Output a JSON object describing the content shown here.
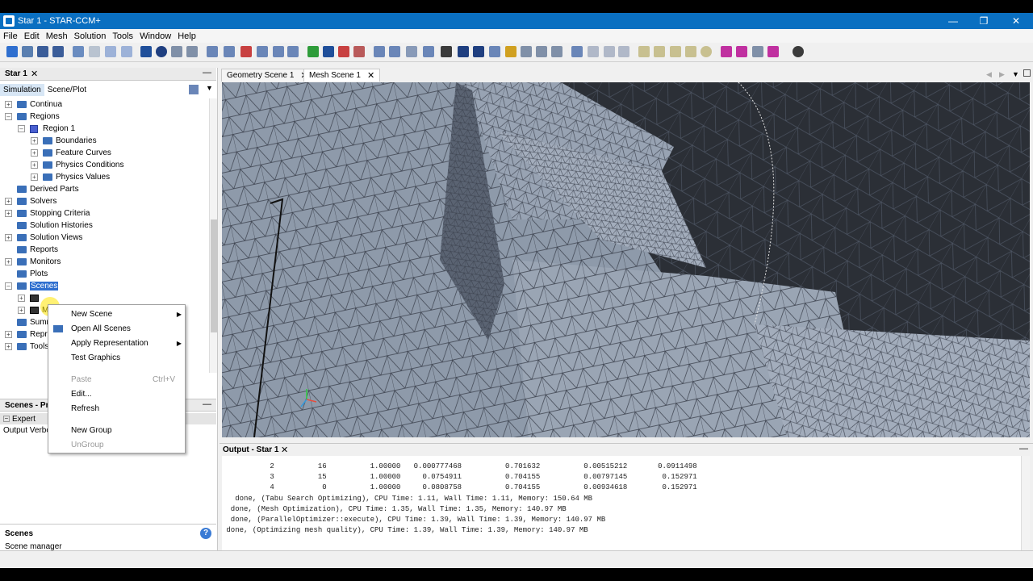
{
  "window": {
    "title": "Star 1 - STAR-CCM+"
  },
  "menu": [
    "File",
    "Edit",
    "Mesh",
    "Solution",
    "Tools",
    "Window",
    "Help"
  ],
  "left_panel": {
    "tab": "Star 1",
    "subtabs": [
      "Simulation",
      "Scene/Plot"
    ],
    "tree": [
      {
        "label": "Continua",
        "level": 0,
        "icon": "folder-icon"
      },
      {
        "label": "Regions",
        "level": 0,
        "icon": "folder-icon"
      },
      {
        "label": "Region 1",
        "level": 1,
        "icon": "region-icon"
      },
      {
        "label": "Boundaries",
        "level": 2,
        "icon": "folder-icon"
      },
      {
        "label": "Feature Curves",
        "level": 2,
        "icon": "folder-icon"
      },
      {
        "label": "Physics Conditions",
        "level": 2,
        "icon": "folder-icon"
      },
      {
        "label": "Physics Values",
        "level": 2,
        "icon": "folder-icon"
      },
      {
        "label": "Derived Parts",
        "level": 0,
        "icon": "folder-icon"
      },
      {
        "label": "Solvers",
        "level": 0,
        "icon": "folder-icon"
      },
      {
        "label": "Stopping Criteria",
        "level": 0,
        "icon": "folder-icon"
      },
      {
        "label": "Solution Histories",
        "level": 0,
        "icon": "folder-icon"
      },
      {
        "label": "Solution Views",
        "level": 0,
        "icon": "folder-icon"
      },
      {
        "label": "Reports",
        "level": 0,
        "icon": "folder-icon"
      },
      {
        "label": "Monitors",
        "level": 0,
        "icon": "folder-icon"
      },
      {
        "label": "Plots",
        "level": 0,
        "icon": "folder-icon"
      },
      {
        "label": "Scenes",
        "level": 0,
        "icon": "folder-icon",
        "selected": true
      },
      {
        "label": "",
        "level": 1,
        "icon": "scene-icon"
      },
      {
        "label": "M",
        "level": 1,
        "icon": "scene-icon"
      },
      {
        "label": "Summ",
        "level": 0,
        "icon": "folder-icon"
      },
      {
        "label": "Repr",
        "level": 0,
        "icon": "folder-icon"
      },
      {
        "label": "Tools",
        "level": 0,
        "icon": "folder-icon"
      }
    ],
    "properties_title": "Scenes - Pr",
    "properties_rows": [
      "Expert",
      "Output Verbo"
    ],
    "help_title": "Scenes",
    "help_desc": "Scene manager"
  },
  "context_menu": [
    {
      "label": "New Scene",
      "submenu": true
    },
    {
      "label": "Open All Scenes",
      "icon": true
    },
    {
      "label": "Apply Representation",
      "submenu": true
    },
    {
      "label": "Test Graphics"
    },
    {
      "label": "Paste",
      "shortcut": "Ctrl+V",
      "disabled": true
    },
    {
      "label": "Edit..."
    },
    {
      "label": "Refresh"
    },
    {
      "label": "New Group"
    },
    {
      "label": "UnGroup",
      "disabled": true
    }
  ],
  "scene_tabs": [
    "Geometry Scene 1",
    "Mesh Scene 1"
  ],
  "active_scene_tab": 1,
  "output": {
    "tab": "Output - Star 1",
    "lines": [
      "           2          16          1.00000   0.000777468          0.701632          0.00515212       0.0911498",
      "           3          15          1.00000     0.0754911          0.704155          0.00797145        0.152971",
      "           4           0          1.00000     0.0808758          0.704155          0.00934618        0.152971",
      "   done, (Tabu Search Optimizing), CPU Time: 1.11, Wall Time: 1.11, Memory: 150.64 MB",
      "  done, (Mesh Optimization), CPU Time: 1.35, Wall Time: 1.35, Memory: 140.97 MB",
      "  done, (ParallelOptimizer::execute), CPU Time: 1.39, Wall Time: 1.39, Memory: 140.97 MB",
      " done, (Optimizing mesh quality), CPU Time: 1.39, Wall Time: 1.39, Memory: 140.97 MB"
    ]
  },
  "colors": {
    "titlebar": "#0a6fc1",
    "selection": "#2f6fcf",
    "folder": "#3a6fb8",
    "mesh_surface": "#8e9aaa",
    "mesh_dark": "#2b2f36"
  }
}
